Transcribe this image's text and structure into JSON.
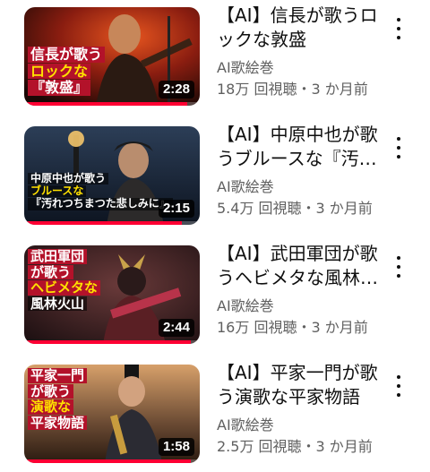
{
  "videos": [
    {
      "title": "【AI】信長が歌うロックな敦盛",
      "channel": "AI歌絵巻",
      "stats": "18万 回視聴・3 か月前",
      "duration": "2:28",
      "progress": 0.93,
      "overlay": [
        "信長が歌う",
        "ロックな",
        "『敦盛』"
      ]
    },
    {
      "title": "【AI】中原中也が歌うブルースな『汚れつちまつた悲しみに』",
      "channel": "AI歌絵巻",
      "stats": "5.4万 回視聴・3 か月前",
      "duration": "2:15",
      "progress": 0.9,
      "overlay": [
        "中原中也が歌う",
        "ブルースな",
        "『汚れつちまつた悲しみに』"
      ]
    },
    {
      "title": "【AI】武田軍団が歌うヘビメタな風林火山",
      "channel": "AI歌絵巻",
      "stats": "16万 回視聴・3 か月前",
      "duration": "2:44",
      "progress": 0.95,
      "overlay": [
        "武田軍団",
        "が歌う",
        "ヘビメタな",
        "風林火山"
      ]
    },
    {
      "title": "【AI】平家一門が歌う演歌な平家物語",
      "channel": "AI歌絵巻",
      "stats": "2.5万 回視聴・3 か月前",
      "duration": "1:58",
      "progress": 0.95,
      "overlay": [
        "平家一門",
        "が歌う",
        "演歌な",
        "平家物語"
      ]
    }
  ]
}
